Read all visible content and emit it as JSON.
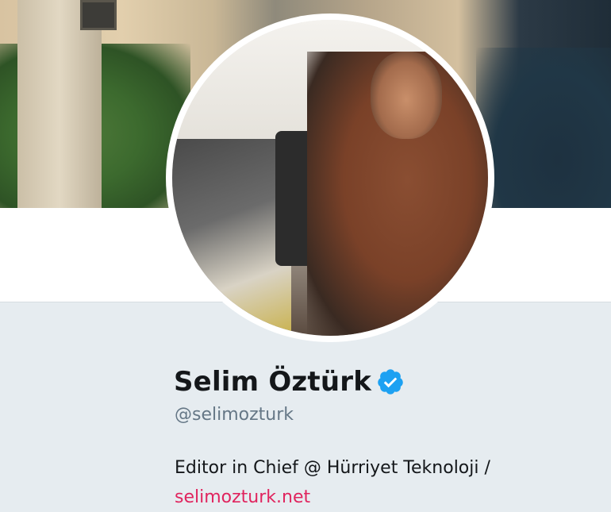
{
  "profile": {
    "display_name": "Selim Öztürk",
    "handle": "@selimozturk",
    "bio_text": "Editor in Chief @ Hürriyet Teknoloji /",
    "bio_link": "selimozturk.net",
    "verified_icon": "verified-badge-icon"
  },
  "colors": {
    "background": "#e6ecf0",
    "name": "#14171a",
    "handle": "#657786",
    "link": "#e0245e",
    "verified": "#1da1f2"
  }
}
